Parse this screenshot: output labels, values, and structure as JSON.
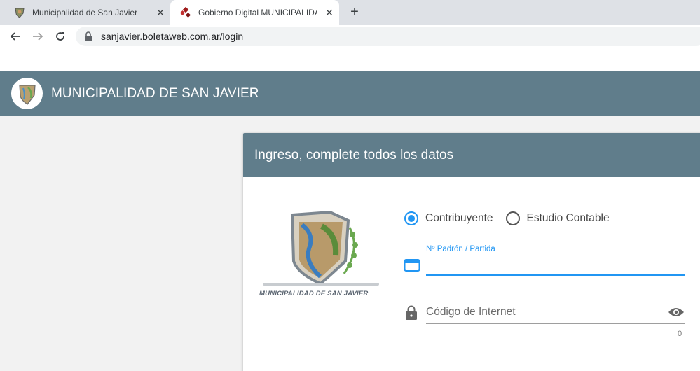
{
  "browser": {
    "tabs": [
      {
        "label": "Municipalidad de San Javier",
        "active": false
      },
      {
        "label": "Gobierno Digital MUNICIPALIDAD",
        "active": true
      }
    ],
    "new_tab_icon": "plus-icon",
    "url": "sanjavier.boletaweb.com.ar/login"
  },
  "appbar": {
    "title": "MUNICIPALIDAD DE SAN JAVIER",
    "color": "#607d8b"
  },
  "login": {
    "header": "Ingreso, complete todos los datos",
    "emblem_caption": "MUNICIPALIDAD DE SAN JAVIER",
    "radio_options": [
      {
        "label": "Contribuyente",
        "selected": true
      },
      {
        "label": "Estudio Contable",
        "selected": false
      }
    ],
    "padron": {
      "label": "Nº Padrón / Partida",
      "value": ""
    },
    "codigo": {
      "placeholder": "Código de Internet",
      "counter": "0"
    }
  },
  "colors": {
    "accent": "#2196f3",
    "header": "#607d8b"
  }
}
